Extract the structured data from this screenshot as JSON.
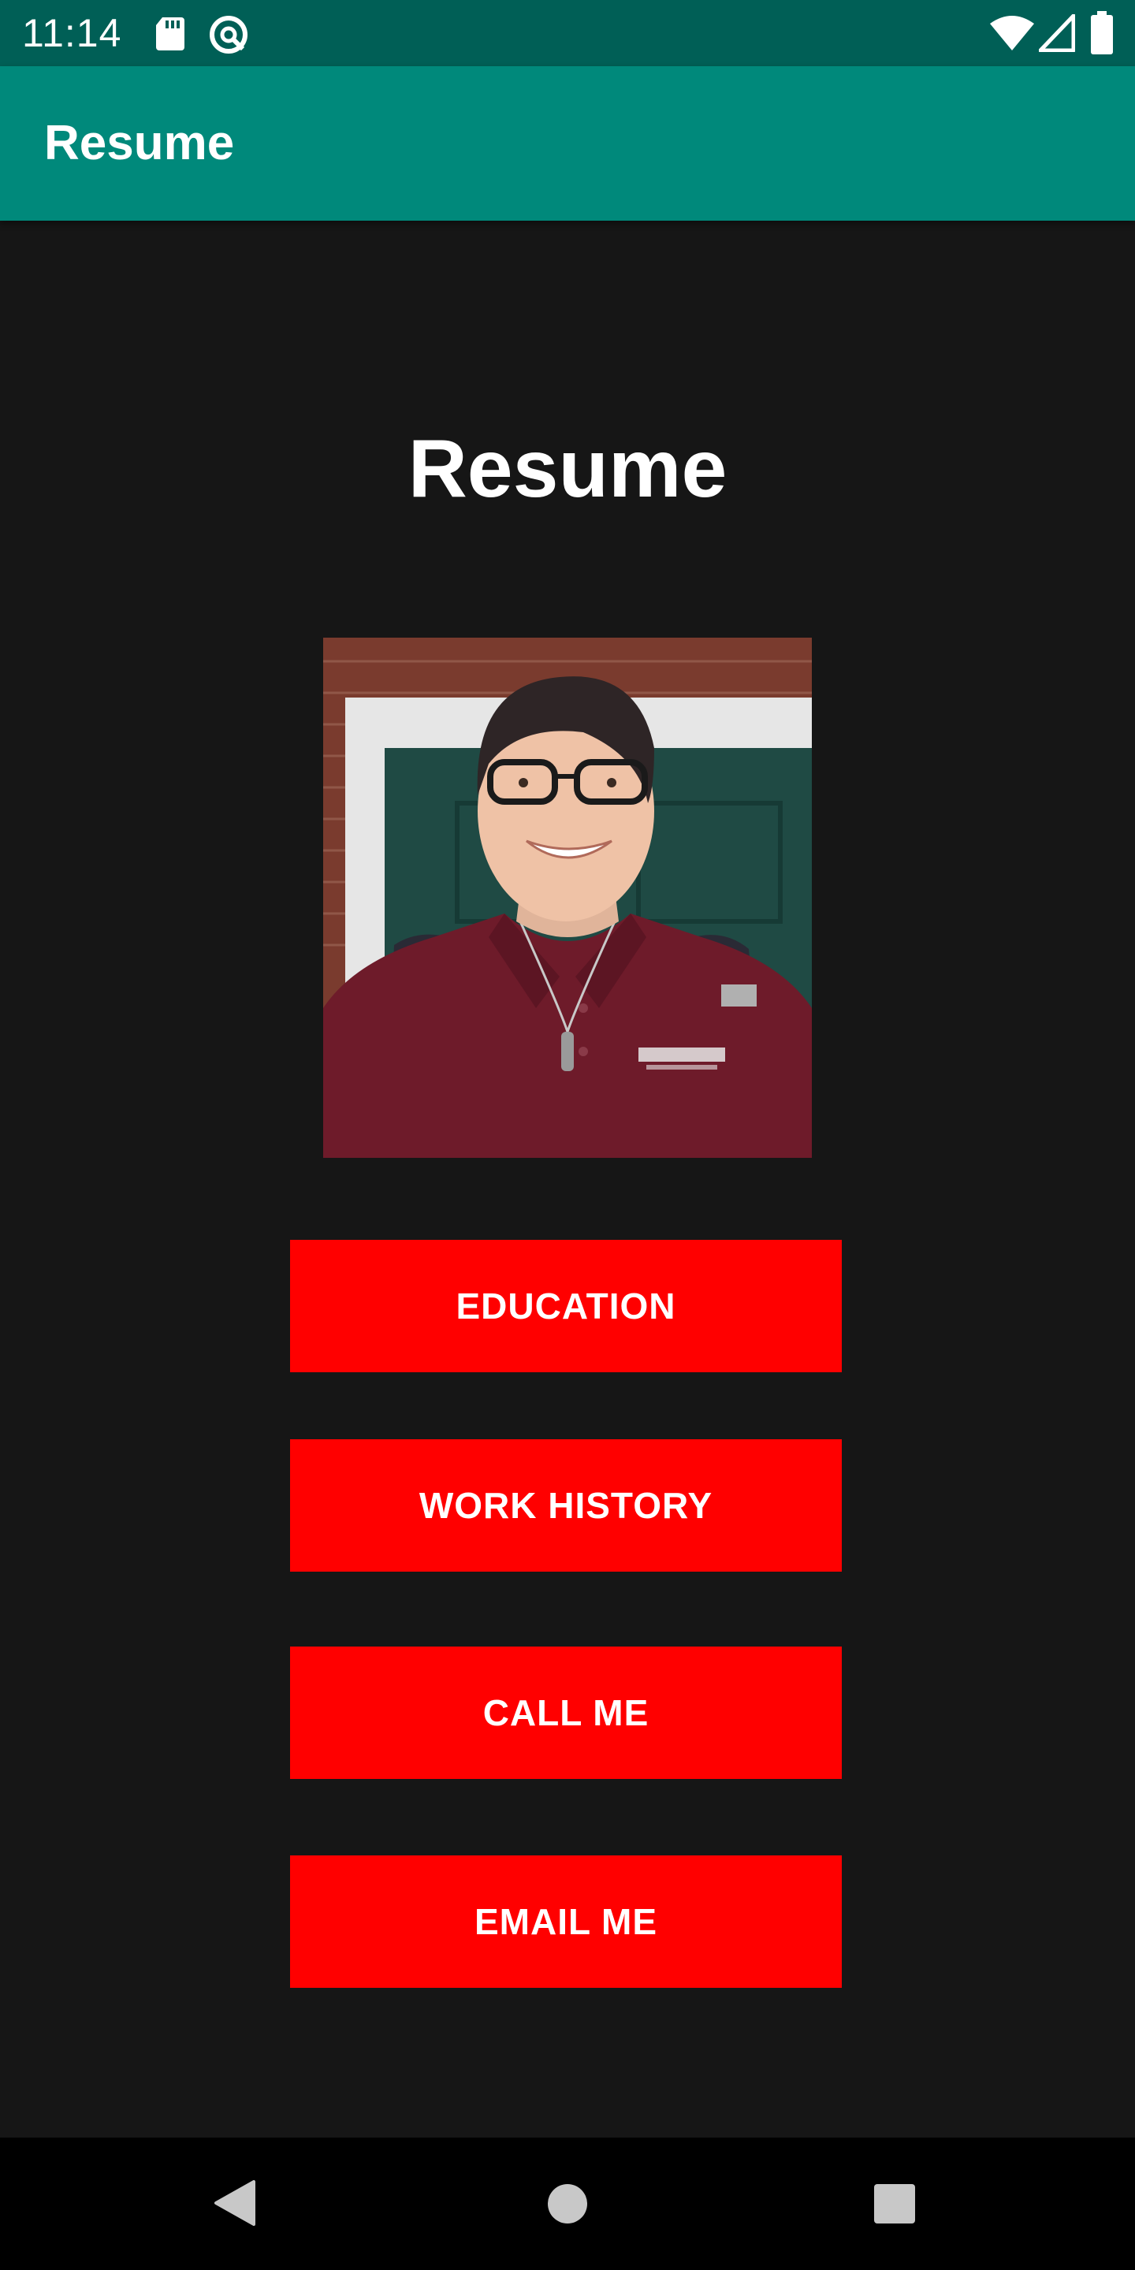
{
  "status_bar": {
    "time": "11:14",
    "icons": [
      "sd-card-icon",
      "q-app-icon",
      "wifi-icon",
      "signal-icon",
      "battery-icon"
    ]
  },
  "app_bar": {
    "title": "Resume",
    "color": "#00897b"
  },
  "main": {
    "heading": "Resume",
    "photo": {
      "description_icon": "profile-photo"
    },
    "buttons": [
      {
        "label": "EDUCATION"
      },
      {
        "label": "WORK HISTORY"
      },
      {
        "label": "CALL ME"
      },
      {
        "label": "EMAIL ME"
      }
    ],
    "button_color": "#ff0000"
  },
  "nav_bar": {
    "icons": [
      "back-icon",
      "home-icon",
      "recents-icon"
    ]
  }
}
